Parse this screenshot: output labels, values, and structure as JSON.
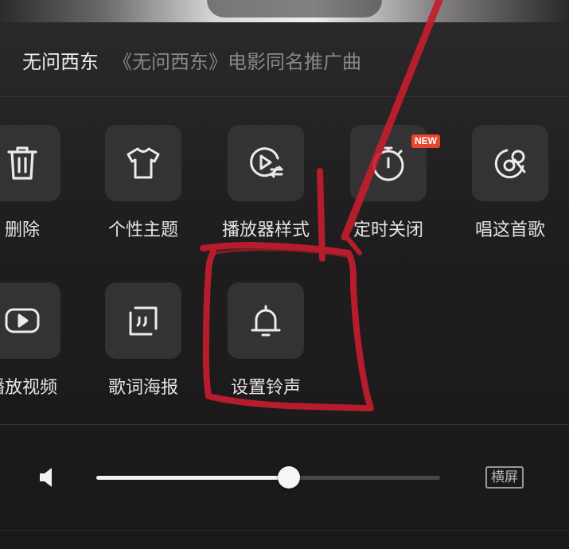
{
  "song": {
    "title": "无问西东",
    "subtitle": "《无问西东》电影同名推广曲"
  },
  "actions_row1": [
    {
      "label": "删除",
      "icon": "trash-icon"
    },
    {
      "label": "个性主题",
      "icon": "tshirt-icon"
    },
    {
      "label": "播放器样式",
      "icon": "player-style-icon"
    },
    {
      "label": "定时关闭",
      "icon": "stopwatch-icon",
      "badge": "NEW"
    },
    {
      "label": "唱这首歌",
      "icon": "sing-record-icon"
    }
  ],
  "actions_row2": [
    {
      "label": "播放视频",
      "icon": "play-video-icon"
    },
    {
      "label": "歌词海报",
      "icon": "lyrics-poster-icon"
    },
    {
      "label": "设置铃声",
      "icon": "bell-icon"
    }
  ],
  "volume": {
    "level_percent": 56,
    "icon": "speaker-icon"
  },
  "landscape_button": {
    "label": "横屏"
  },
  "colors": {
    "badge": "#e8472f",
    "annotation": "#c41e2e",
    "background": "#1c1a1b"
  }
}
